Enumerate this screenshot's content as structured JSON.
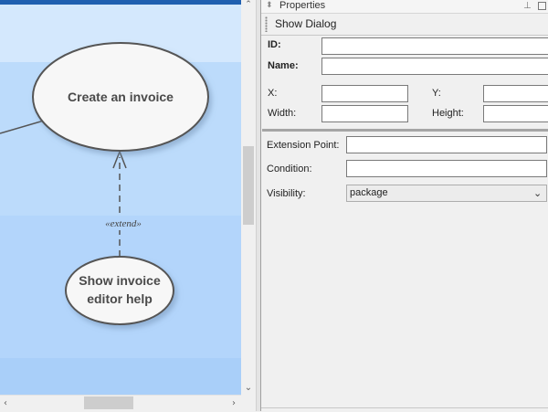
{
  "diagram": {
    "use_case_main": "Create an invoice",
    "use_case_help_line1": "Show invoice",
    "use_case_help_line2": "editor help",
    "relation_stereotype": "«extend»"
  },
  "scrollbars": {
    "up_arrow": "⌃",
    "down_arrow": "⌄",
    "left_arrow": "‹",
    "right_arrow": "›"
  },
  "panel": {
    "title": "Properties",
    "element_title": "Show Dialog",
    "fields": {
      "id_label": "ID:",
      "id_value": "",
      "name_label": "Name:",
      "name_value": "",
      "x_label": "X:",
      "x_value": "",
      "y_label": "Y:",
      "y_value": "",
      "width_label": "Width:",
      "width_value": "",
      "height_label": "Height:",
      "height_value": "",
      "extension_point_label": "Extension Point:",
      "extension_point_value": "",
      "condition_label": "Condition:",
      "condition_value": "",
      "visibility_label": "Visibility:",
      "visibility_value": "package"
    },
    "icons": {
      "pin": "pin-icon",
      "restore": "restore-icon",
      "chevron": "chevron-down-icon"
    }
  },
  "colors": {
    "canvas_top": "#d4e8fd",
    "canvas_band": "#b9d9fb",
    "ellipse_fill": "#f7f7f7",
    "ellipse_stroke": "#555555",
    "title_bar": "#1f5fb0"
  }
}
